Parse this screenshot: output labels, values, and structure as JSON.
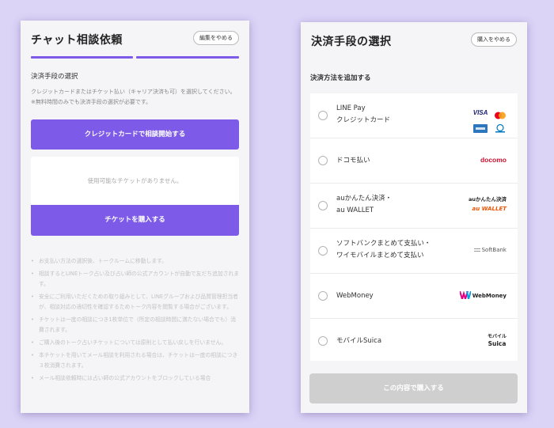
{
  "left": {
    "title": "チャット相談依頼",
    "quit_label": "編集をやめる",
    "section_label": "決済手段の選択",
    "description": "クレジットカードまたはチケット払い（キャリア決済も可）を選択してください。※無料時間のみでも決済手段の選択が必要です。",
    "credit_button": "クレジットカードで相談開始する",
    "no_ticket_text": "使用可能なチケットがありません。",
    "buy_ticket_button": "チケットを購入する",
    "notes": [
      "お支払い方法の選択後、トークルームに移動します。",
      "相談するとLINEトーク占い及び占い師の公式アカウントが自動で友だち追加されます。",
      "安全にご利用いただくための取り組みとして、LINEグループおよび品質管理担当者が、相談対応の適切性を確認するためトーク内容を閲覧する場合がございます。",
      "チケットは一度の相談につき1枚単位で（所定の相談時間に満たない場合でも）消費されます。",
      "ご購入後のトーク占いチケットについては原則として払い戻しを行いません。",
      "本チケットを用いてメール相談を利用される場合は、チケットは一度の相談につき３枚消費されます。",
      "メール相談依頼時には占い師の公式アカウントをブロックしている場合"
    ]
  },
  "right": {
    "title": "決済手段の選択",
    "quit_label": "購入をやめる",
    "section_label": "決済方法を追加する",
    "methods": [
      {
        "line1": "LINE Pay",
        "line2": "クレジットカード"
      },
      {
        "line1": "ドコモ払い",
        "line2": ""
      },
      {
        "line1": "auかんたん決済・",
        "line2": "au WALLET"
      },
      {
        "line1": "ソフトバンクまとめて支払い・",
        "line2": "ワイモバイルまとめて支払い"
      },
      {
        "line1": "WebMoney",
        "line2": ""
      },
      {
        "line1": "モバイルSuica",
        "line2": ""
      }
    ],
    "logos": {
      "visa": "VISA",
      "docomo": "docomo",
      "au_top": "auかんたん決済",
      "au_bottom": "au WALLET",
      "softbank": "SoftBank",
      "webmoney": "WebMoney",
      "suica_top": "モバイル",
      "suica_bottom": "Suica"
    },
    "purchase_button": "この内容で購入する"
  },
  "colors": {
    "accent": "#7d5be8",
    "background": "#dcd4f7",
    "disabled": "#cfcfcf"
  }
}
